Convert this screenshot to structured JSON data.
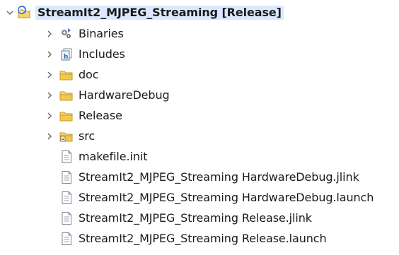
{
  "tree": {
    "root": {
      "label": "StreamIt2_MJPEG_Streaming [Release]",
      "expanded": true,
      "icon": "c-project-icon"
    },
    "children": [
      {
        "label": "Binaries",
        "icon": "binaries-icon",
        "expandable": true
      },
      {
        "label": "Includes",
        "icon": "includes-icon",
        "expandable": true
      },
      {
        "label": "doc",
        "icon": "folder-icon",
        "expandable": true
      },
      {
        "label": "HardwareDebug",
        "icon": "folder-icon",
        "expandable": true
      },
      {
        "label": "Release",
        "icon": "folder-icon",
        "expandable": true
      },
      {
        "label": "src",
        "icon": "source-folder-icon",
        "expandable": true
      },
      {
        "label": "makefile.init",
        "icon": "file-icon",
        "expandable": false
      },
      {
        "label": "StreamIt2_MJPEG_Streaming HardwareDebug.jlink",
        "icon": "file-icon",
        "expandable": false
      },
      {
        "label": "StreamIt2_MJPEG_Streaming HardwareDebug.launch",
        "icon": "file-icon",
        "expandable": false
      },
      {
        "label": "StreamIt2_MJPEG_Streaming Release.jlink",
        "icon": "file-icon",
        "expandable": false
      },
      {
        "label": "StreamIt2_MJPEG_Streaming Release.launch",
        "icon": "file-icon",
        "expandable": false
      }
    ]
  },
  "colors": {
    "selection": "#dbe9ff",
    "folder": "#f2c94c",
    "twisty": "#6b6b6b"
  }
}
